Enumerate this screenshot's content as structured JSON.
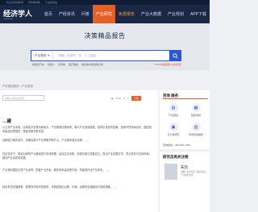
{
  "topbar": {
    "items": [
      "欢迎来到前瞻网",
      "手机看前瞻",
      "行业精选站"
    ]
  },
  "nav": {
    "logo": "经济学人",
    "logo_sub": "QIANZHAN",
    "items": [
      "首页",
      "产经资讯",
      "问答",
      "产业研究",
      "免费报告",
      "产业大数据",
      "产业规划",
      "APP下载"
    ],
    "active_index": 3,
    "hot_index": 4
  },
  "hero": {
    "title": "决策精品报告",
    "search_category": "产业规划",
    "search_placeholder": "请输入关键词，如：人工智能",
    "hot_tags": [
      "新能源汽车",
      "机器人",
      "半导体",
      "医疗器械",
      "跨境电商新政策分析"
    ],
    "hot_right": "5000+精品报告 在线阅读"
  },
  "breadcrumb": "产业规划首页 > 产业咨询",
  "main": {
    "filter_placeholder": "请输入资料关键词",
    "views": "1007",
    "likes": "2",
    "action": "下载",
    "section_title": "…建",
    "paragraphs": [
      "从主导产业来看，区域经济总量持续增长，产业集群加快培育，新兴产业快速发展，招商引资成效显著，营商环境持续优化，园区载体建设加快推进，基础设施不断完善，",
      "创新能力稳步提升，战略性新兴产业规模不断扩大，产业链条逐步延伸，…。",
      "在此背景下，规划对现有产业基础进行系统梳理，结合区位优势、资源禀赋与发展定位，提出产业发展方向、重点任务与空间布局，推动产业高质量发展。",
      "产业规划围绕主导产业培育、配套产业完善、服务体系建设等方面，构建现代化产业体系，…。",
      "综合考虑发展趋势、政策导向和市场需求，本规划提出近期、中期、远期的实施路径与保障措施，…。"
    ]
  },
  "side": {
    "service_title": "咨询 服务",
    "services": [
      "产业规划",
      "园区规划",
      "可行性研究",
      "专项咨询报告"
    ],
    "phone": "咨询热线：400-068-7188",
    "experts_title": "研究员再关注榜",
    "expert_name": "朱凯",
    "expert_desc": "前瞻产业研究院 高级研究员 产业规划专家"
  }
}
